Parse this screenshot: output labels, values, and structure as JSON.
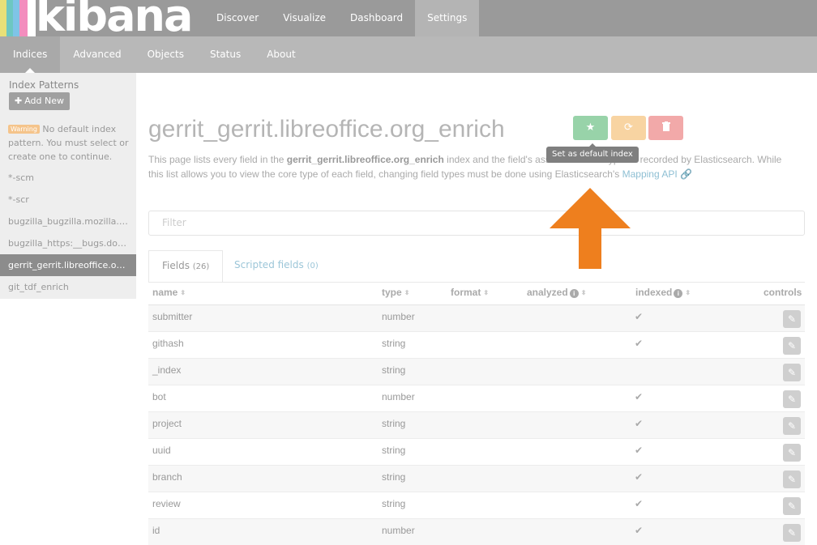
{
  "brand": {
    "logo_text": "kibana",
    "stripe_colors": [
      "#e8e078",
      "#6dc7c2",
      "#7fc4e7",
      "#f38dbe",
      "#ffffff"
    ]
  },
  "top_nav": [
    {
      "label": "Discover",
      "active": false
    },
    {
      "label": "Visualize",
      "active": false
    },
    {
      "label": "Dashboard",
      "active": false
    },
    {
      "label": "Settings",
      "active": true
    }
  ],
  "sub_nav": [
    {
      "label": "Indices",
      "active": true
    },
    {
      "label": "Advanced",
      "active": false
    },
    {
      "label": "Objects",
      "active": false
    },
    {
      "label": "Status",
      "active": false
    },
    {
      "label": "About",
      "active": false
    }
  ],
  "sidebar": {
    "heading": "Index Patterns",
    "add_new_label": "Add New",
    "warning_badge": "Warning",
    "warning_text": "No default index pattern. You must select or create one to continue.",
    "items": [
      {
        "label": "*-scm",
        "active": false
      },
      {
        "label": "*-scr",
        "active": false
      },
      {
        "label": "bugzilla_bugzilla.mozilla.org",
        "active": false
      },
      {
        "label": "bugzilla_https:__bugs.documentfoundation.org",
        "active": false
      },
      {
        "label": "gerrit_gerrit.libreoffice.org_enrich",
        "active": true
      },
      {
        "label": "git_tdf_enrich",
        "active": false
      }
    ]
  },
  "main": {
    "title": "gerrit_gerrit.libreoffice.org_enrich",
    "tooltip": "Set as default index",
    "desc_pre": "This page lists every field in the ",
    "desc_index": "gerrit_gerrit.libreoffice.org_enrich",
    "desc_mid": " index and the field's associated core type as recorded by Elasticsearch. While this list allows you to view the core type of each field, changing field types must be done using Elasticsearch's ",
    "desc_link": "Mapping API",
    "filter_placeholder": "Filter",
    "tabs": {
      "fields_label": "Fields",
      "fields_count": "(26)",
      "scripted_label": "Scripted fields",
      "scripted_count": "(0)"
    },
    "columns": {
      "name": "name",
      "type": "type",
      "format": "format",
      "analyzed": "analyzed",
      "indexed": "indexed",
      "controls": "controls"
    },
    "rows": [
      {
        "name": "submitter",
        "type": "number",
        "indexed": true
      },
      {
        "name": "githash",
        "type": "string",
        "indexed": true
      },
      {
        "name": "_index",
        "type": "string",
        "indexed": false
      },
      {
        "name": "bot",
        "type": "number",
        "indexed": true
      },
      {
        "name": "project",
        "type": "string",
        "indexed": true
      },
      {
        "name": "uuid",
        "type": "string",
        "indexed": true
      },
      {
        "name": "branch",
        "type": "string",
        "indexed": true
      },
      {
        "name": "review",
        "type": "string",
        "indexed": true
      },
      {
        "name": "id",
        "type": "number",
        "indexed": true
      }
    ]
  },
  "colors": {
    "arrow": "#ee7f1e",
    "default_button": "#98d3a9",
    "refresh_button": "#f8d4a2",
    "delete_button": "#f2a9a9",
    "warning_badge": "#f5c48b"
  },
  "icons": {
    "default_button": "star-icon",
    "refresh_button": "refresh-icon",
    "delete_button": "trash-icon",
    "edit_button": "pencil-icon",
    "indexed": "check-icon",
    "mapping_link": "link-icon"
  }
}
